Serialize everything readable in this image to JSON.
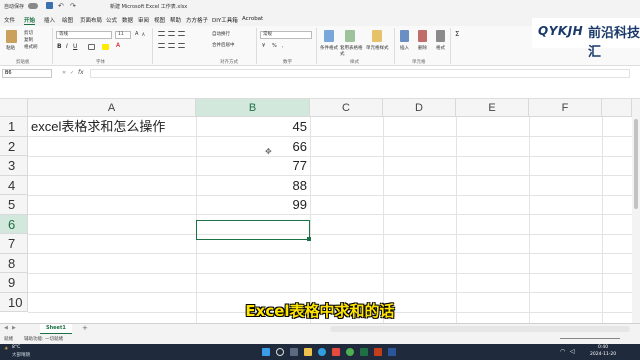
{
  "window": {
    "autosave": "自动保存",
    "title": "新建 Microsoft Excel 工作表.xlsx"
  },
  "tabs": [
    "文件",
    "开始",
    "插入",
    "绘图",
    "页面布局",
    "公式",
    "数据",
    "审阅",
    "视图",
    "帮助",
    "方方格子",
    "DIY工具箱",
    "Acrobat"
  ],
  "active_tab": "开始",
  "ribbon": {
    "paste": "粘贴",
    "cut": "剪切",
    "copy": "复制",
    "format_painter": "格式刷",
    "font_name": "等线",
    "font_size": "11",
    "wrap_text": "自动换行",
    "merge_center": "合并后居中",
    "number_format": "常规",
    "conditional_format": "条件格式",
    "table_format": "套用表格格式",
    "cell_style": "单元格样式",
    "insert": "插入",
    "delete": "删除",
    "format": "格式",
    "groups": {
      "clipboard": "剪贴板",
      "font": "字体",
      "alignment": "对齐方式",
      "number": "数字",
      "styles": "样式",
      "cells": "单元格"
    }
  },
  "logo": {
    "brand": "QYKJH",
    "chinese": "前沿科技汇"
  },
  "formula_bar": {
    "name_box": "B6",
    "fx": "fx",
    "content": ""
  },
  "columns": [
    "A",
    "B",
    "C",
    "D",
    "E",
    "F"
  ],
  "rows": [
    "1",
    "2",
    "3",
    "4",
    "5",
    "6",
    "7",
    "8",
    "9",
    "10"
  ],
  "cells": {
    "A1": "excel表格求和怎么操作",
    "B1": "45",
    "B2": "66",
    "B3": "77",
    "B4": "88",
    "B5": "99"
  },
  "selected_cell": "B6",
  "sheet_tabs": [
    "Sheet1"
  ],
  "status": {
    "ready": "就绪",
    "accessibility": "辅助功能: 一切就绪"
  },
  "subtitle": "Excel表格中求和的话",
  "taskbar": {
    "weather_temp": "8°C",
    "weather_desc": "大部晴朗",
    "time": "0:40",
    "date": "2024-11-20"
  },
  "colors": {
    "excel_green": "#1e7145",
    "subtitle_yellow": "#ffe400",
    "taskbar": "#1f2a3c"
  }
}
